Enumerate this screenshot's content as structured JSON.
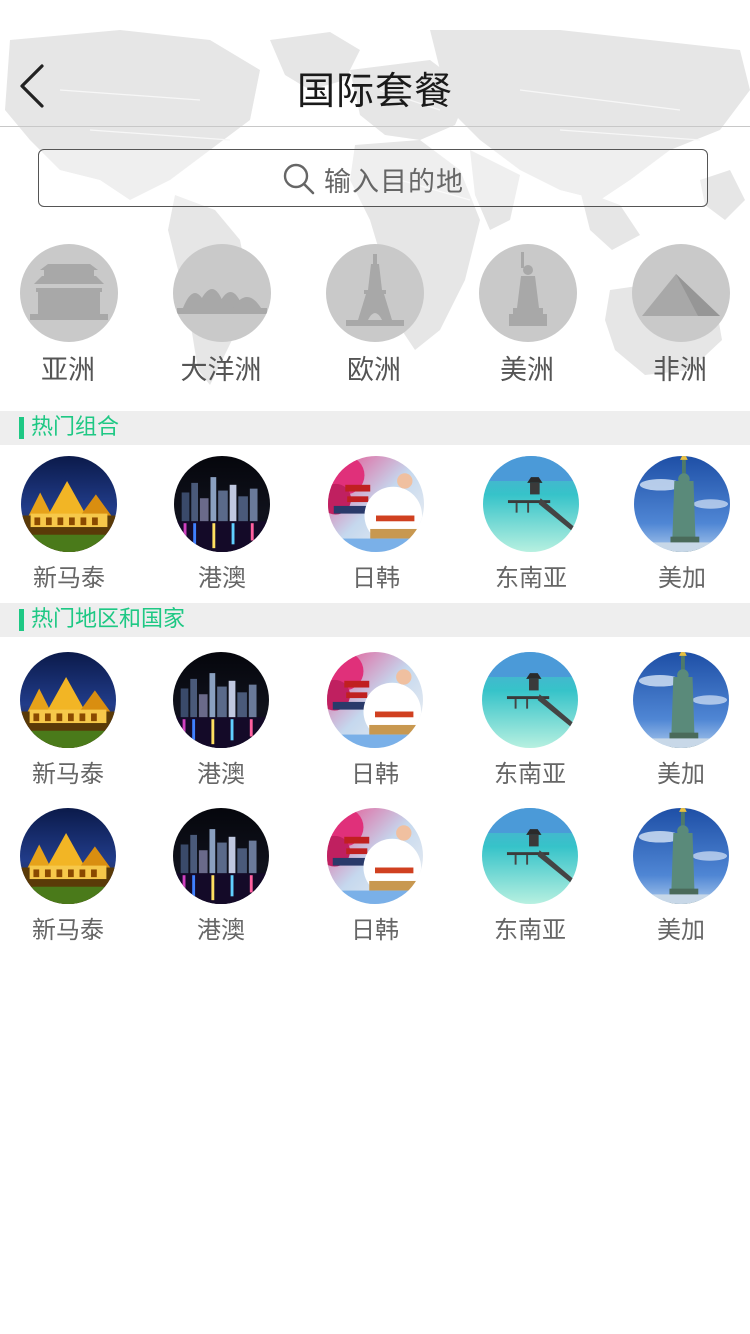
{
  "header": {
    "title": "国际套餐",
    "back_icon": "chevron-left-icon"
  },
  "search": {
    "placeholder": "输入目的地",
    "icon": "search-icon"
  },
  "continents": [
    {
      "label": "亚洲",
      "icon": "asian-palace-icon"
    },
    {
      "label": "大洋洲",
      "icon": "opera-house-icon"
    },
    {
      "label": "欧洲",
      "icon": "eiffel-tower-icon"
    },
    {
      "label": "美洲",
      "icon": "statue-of-liberty-icon"
    },
    {
      "label": "非洲",
      "icon": "pyramid-icon"
    }
  ],
  "sections": {
    "hot_combos": {
      "title": "热门组合",
      "items": [
        {
          "label": "新马泰",
          "image": "thai-temple-night-photo"
        },
        {
          "label": "港澳",
          "image": "hong-kong-night-skyline-photo"
        },
        {
          "label": "日韩",
          "image": "japan-korea-collage-photo"
        },
        {
          "label": "东南亚",
          "image": "tropical-pier-photo"
        },
        {
          "label": "美加",
          "image": "statue-of-liberty-photo"
        }
      ]
    },
    "hot_regions": {
      "title": "热门地区和国家",
      "rows": [
        [
          {
            "label": "新马泰",
            "image": "thai-temple-night-photo"
          },
          {
            "label": "港澳",
            "image": "hong-kong-night-skyline-photo"
          },
          {
            "label": "日韩",
            "image": "japan-korea-collage-photo"
          },
          {
            "label": "东南亚",
            "image": "tropical-pier-photo"
          },
          {
            "label": "美加",
            "image": "statue-of-liberty-photo"
          }
        ],
        [
          {
            "label": "新马泰",
            "image": "thai-temple-night-photo"
          },
          {
            "label": "港澳",
            "image": "hong-kong-night-skyline-photo"
          },
          {
            "label": "日韩",
            "image": "japan-korea-collage-photo"
          },
          {
            "label": "东南亚",
            "image": "tropical-pier-photo"
          },
          {
            "label": "美加",
            "image": "statue-of-liberty-photo"
          }
        ]
      ]
    }
  },
  "colors": {
    "accent": "#1ec884",
    "section_bg": "#eeeeee",
    "text_gray": "#666666",
    "map_gray": "#e6e6e6"
  }
}
